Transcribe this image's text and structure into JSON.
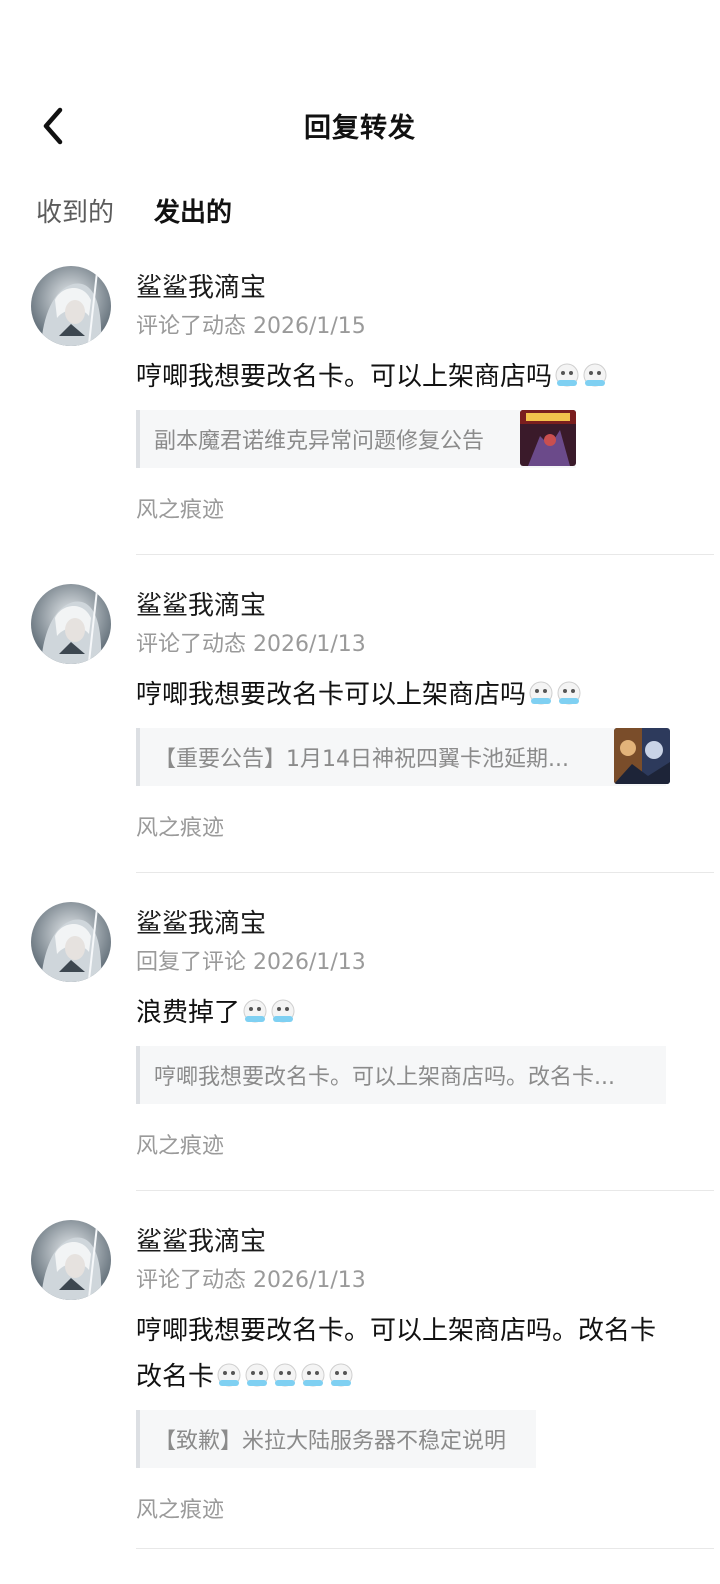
{
  "header": {
    "title": "回复转发"
  },
  "tabs": [
    {
      "label": "收到的",
      "active": false
    },
    {
      "label": "发出的",
      "active": true
    }
  ],
  "colors": {
    "accent": "#2fd3c3",
    "meta_text": "#9a9a9a",
    "quote_bg": "#f6f7f8"
  },
  "items": [
    {
      "author": "鲨鲨我滴宝",
      "meta": "评论了动态 2026/1/15",
      "content": "哼唧我想要改名卡。可以上架商店吗",
      "emoji_count": 2,
      "emoji_icon": "crying-face-icon",
      "quote": "副本魔君诺维克异常问题修复公告",
      "quote_thumb_icon": "post-thumbnail-icon",
      "source": "风之痕迹"
    },
    {
      "author": "鲨鲨我滴宝",
      "meta": "评论了动态 2026/1/13",
      "content": "哼唧我想要改名卡可以上架商店吗",
      "emoji_count": 2,
      "emoji_icon": "crying-face-icon",
      "quote": "【重要公告】1月14日神祝四翼卡池延期...",
      "quote_thumb_icon": "post-thumbnail-icon",
      "source": "风之痕迹"
    },
    {
      "author": "鲨鲨我滴宝",
      "meta": "回复了评论 2026/1/13",
      "content": "浪费掉了",
      "emoji_count": 2,
      "emoji_icon": "crying-face-icon",
      "quote": "哼唧我想要改名卡。可以上架商店吗。改名卡...",
      "source": "风之痕迹"
    },
    {
      "author": "鲨鲨我滴宝",
      "meta": "评论了动态 2026/1/13",
      "content": "哼唧我想要改名卡。可以上架商店吗。改名卡改名卡",
      "emoji_count": 5,
      "emoji_icon": "crying-face-icon",
      "quote": "【致歉】米拉大陆服务器不稳定说明",
      "source": "风之痕迹"
    }
  ]
}
